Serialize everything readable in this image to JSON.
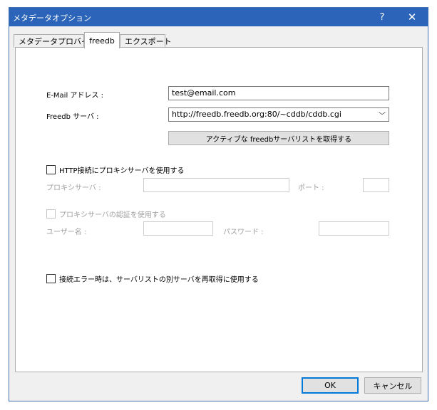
{
  "window": {
    "title": "メタデータオプション",
    "help_glyph": "?",
    "close_glyph": "✕"
  },
  "tabs": [
    {
      "label": "メタデータプロバイダ",
      "active": false
    },
    {
      "label": "freedb",
      "active": true
    },
    {
      "label": "エクスポート",
      "active": false
    }
  ],
  "freedb": {
    "email_label": "E-Mail アドレス :",
    "email_value": "test@email.com",
    "server_label": "Freedb サーバ :",
    "server_value": "http://freedb.freedb.org:80/~cddb/cddb.cgi",
    "fetch_button": "アクティブな freedbサーバリストを取得する",
    "http_proxy_checkbox": "HTTP接続にプロキシサーバを使用する",
    "proxy_server_label": "プロキシサーバ :",
    "proxy_server_value": "",
    "port_label": "ポート :",
    "port_value": "",
    "proxy_auth_checkbox": "プロキシサーバの認証を使用する",
    "username_label": "ユーザー名 :",
    "username_value": "",
    "password_label": "パスワード :",
    "password_value": "",
    "retry_checkbox": "接続エラー時は、サーバリストの別サーバを再取得に使用する"
  },
  "footer": {
    "ok": "OK",
    "cancel": "キャンセル"
  }
}
